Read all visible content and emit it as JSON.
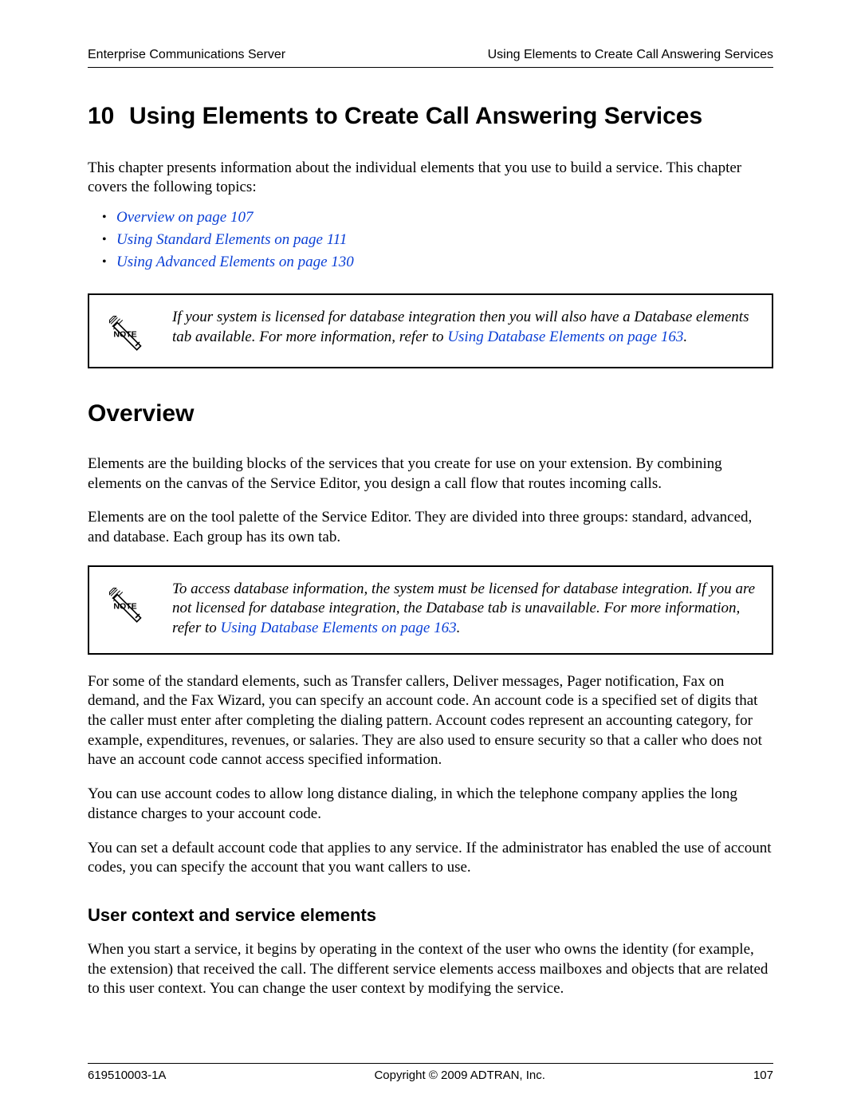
{
  "header": {
    "left": "Enterprise Communications Server",
    "right": "Using Elements to Create Call Answering Services"
  },
  "chapter": {
    "number": "10",
    "title": "Using Elements to Create Call Answering Services"
  },
  "intro": "This chapter presents information about the individual elements that you use to build a service. This chapter covers the following topics:",
  "toc": [
    "Overview on page 107",
    "Using Standard Elements on page 111",
    "Using Advanced Elements on page 130"
  ],
  "note1": {
    "label": "NOTE",
    "pre": "If your system is licensed for database integration then you will also have a Database elements tab available. For more information, refer to ",
    "link": "Using Database Elements on page 163",
    "post": "."
  },
  "overview": {
    "heading": "Overview",
    "p1": "Elements are the building blocks of the services that you create for use on your extension. By combining elements on the canvas of the Service Editor, you design a call flow that routes incoming calls.",
    "p2": "Elements are on the tool palette of the Service Editor. They are divided into three groups: standard, advanced, and database. Each group has its own tab."
  },
  "note2": {
    "label": "NOTE",
    "pre": "To access database information, the system must be licensed for database integration. If you are not licensed for database integration, the Database tab is unavailable. For more information, refer to ",
    "link": "Using Database Elements on page 163",
    "post": "."
  },
  "body": {
    "p3": "For some of the standard elements, such as Transfer callers, Deliver messages, Pager notification, Fax on demand, and the Fax Wizard, you can specify an account code. An account code is a specified set of digits that the caller must enter after completing the dialing pattern. Account codes represent an accounting category, for example, expenditures, revenues, or salaries. They are also used to ensure security so that a caller who does not have an account code cannot access specified information.",
    "p4": "You can use account codes to allow long distance dialing, in which the telephone company applies the long distance charges to your account code.",
    "p5": "You can set a default account code that applies to any service. If the administrator has enabled the use of account codes, you can specify the account that you want callers to use."
  },
  "subsection": {
    "heading": "User context and service elements",
    "p6": "When you start a service, it begins by operating in the context of the user who owns the identity (for example, the extension) that received the call. The different service elements access mailboxes and objects that are related to this user context. You can change the user context by modifying the service."
  },
  "footer": {
    "left": "619510003-1A",
    "center": "Copyright © 2009 ADTRAN, Inc.",
    "right": "107"
  }
}
